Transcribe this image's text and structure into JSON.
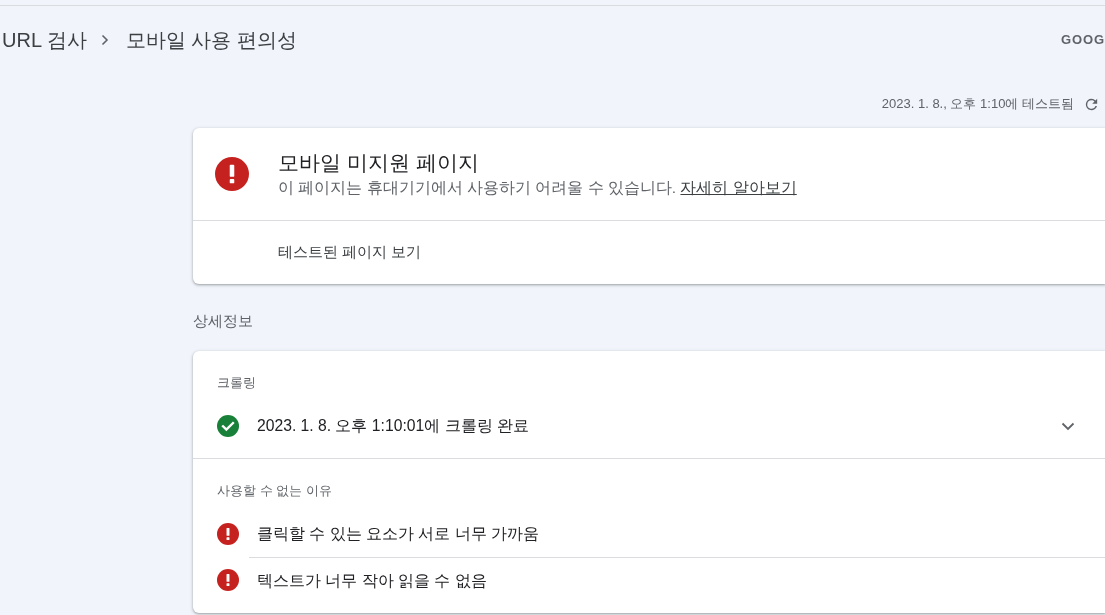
{
  "header": {
    "breadcrumb": [
      {
        "label": "URL 검사"
      },
      {
        "label": "모바일 사용 편의성"
      }
    ],
    "right_text": "GOOG"
  },
  "test_time": "2023. 1. 8., 오후 1:10에 테스트됨",
  "verdict_card": {
    "kind": "error",
    "title": "모바일 미지원 페이지",
    "description": "이 페이지는 휴대기기에서 사용하기 어려울 수 있습니다.",
    "link": "자세히 알아보기",
    "action": "테스트된 페이지 보기"
  },
  "details_heading": "상세정보",
  "crawl": {
    "heading": "크롤링",
    "kind": "success",
    "text": "2023. 1. 8. 오후 1:10:01에 크롤링 완료",
    "expanded": false
  },
  "issues": {
    "heading": "사용할 수 없는 이유",
    "items": [
      {
        "kind": "error",
        "text": "클릭할 수 있는 요소가 서로 너무 가까움"
      },
      {
        "kind": "error",
        "text": "텍스트가 너무 작아 읽을 수 없음"
      }
    ]
  }
}
